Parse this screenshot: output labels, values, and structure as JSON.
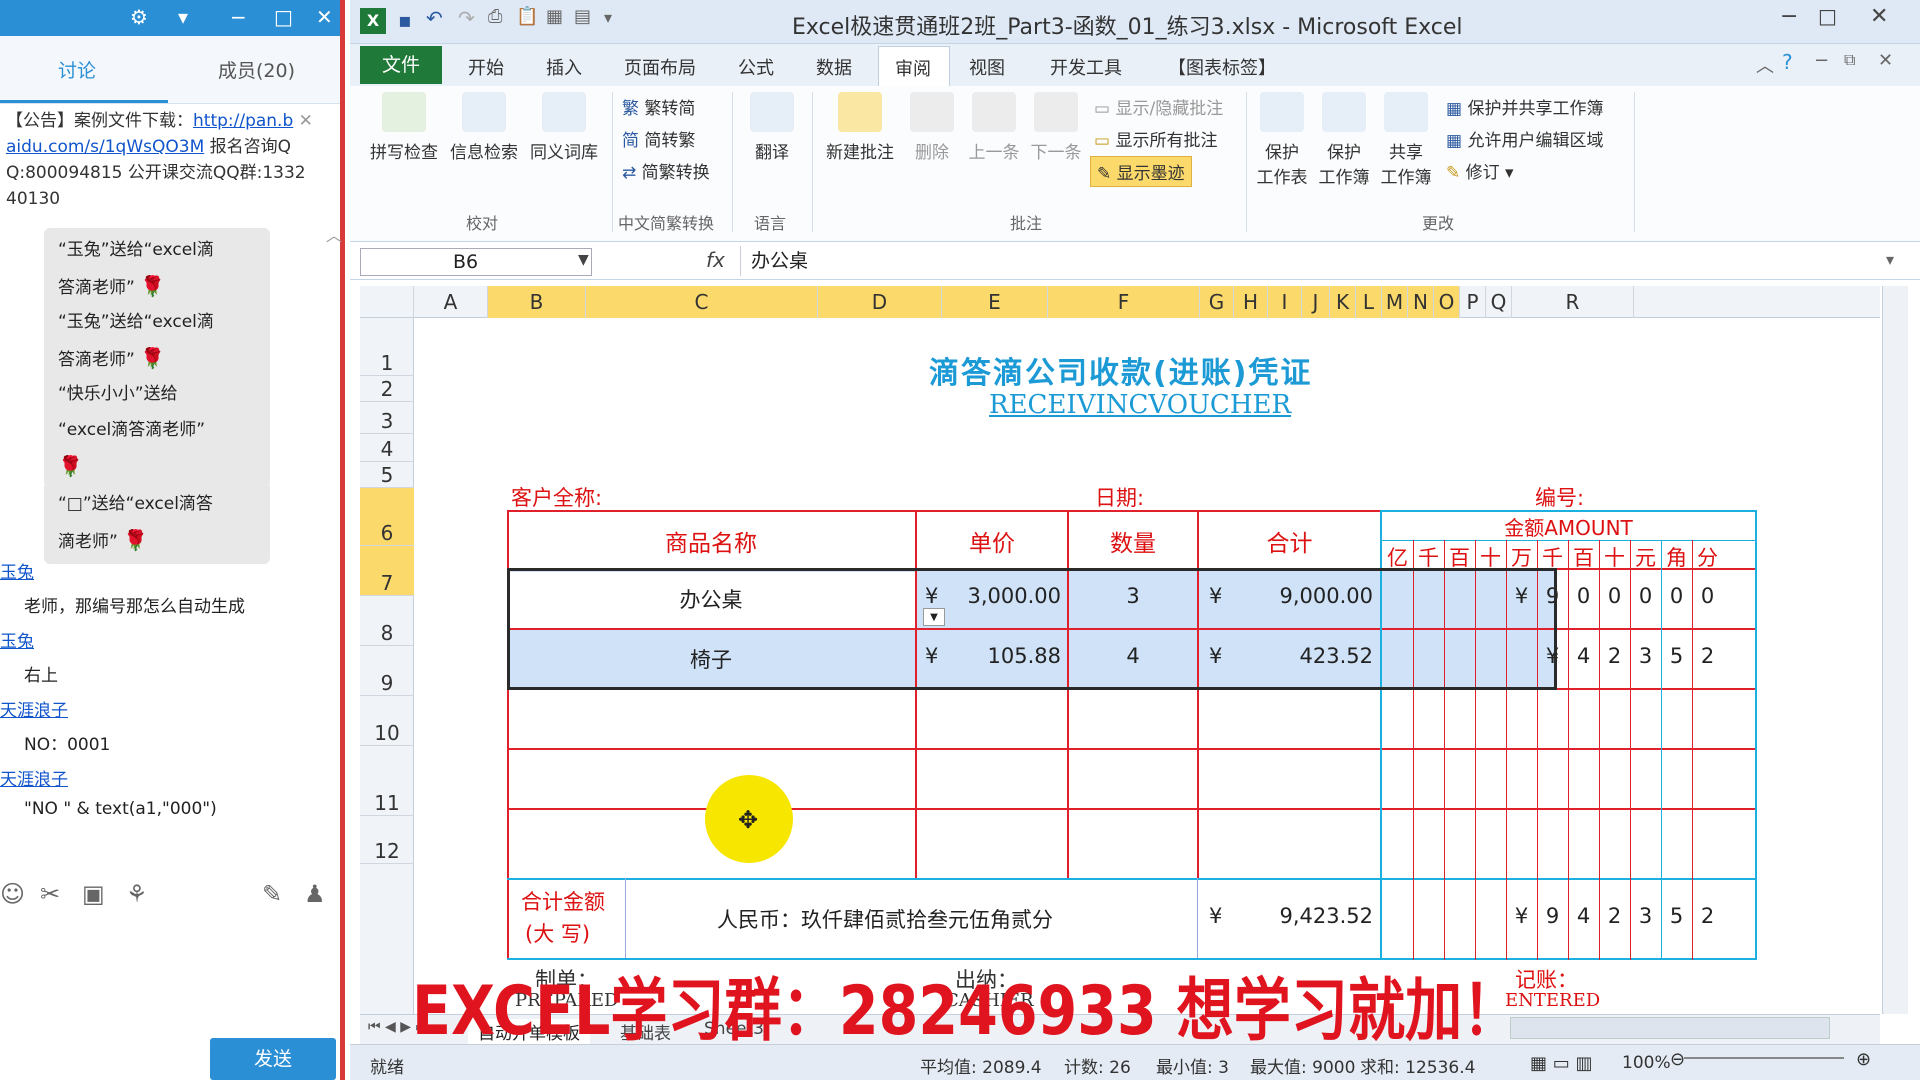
{
  "chat": {
    "tabs": [
      "讨论",
      "成员(20)"
    ],
    "announcement": {
      "prefix": "【公告】",
      "text1": "案例文件下载：",
      "link1": "http://pan.b",
      "link2": "aidu.com/s/1qWsQO3M",
      "text2": " 报名咨询Q",
      "text3": "Q:800094815  公开课交流QQ群:1332",
      "text4": "40130"
    },
    "gifts": [
      {
        "line1": "“玉兔”送给“excel滴",
        "line2": "答滴老师”"
      },
      {
        "line1": "“玉兔”送给“excel滴",
        "line2": "答滴老师”"
      },
      {
        "line1": "“快乐小小”送给",
        "line2": "“excel滴答滴老师”"
      },
      {
        "line1": "“□”送给“excel滴答",
        "line2": "滴老师”"
      }
    ],
    "messages": [
      {
        "user": "玉兔",
        "text": "老师，那编号那怎么自动生成"
      },
      {
        "user": "玉兔",
        "text": "右上"
      },
      {
        "user": "天涯浪子",
        "text": "NO：0001"
      },
      {
        "user": "天涯浪子",
        "text": "\"NO \" &  text(a1,\"000\")"
      }
    ],
    "send_label": "发送"
  },
  "excel": {
    "title": "Excel极速贯通班2班_Part3-函数_01_练习3.xlsx - Microsoft Excel",
    "file_tab": "文件",
    "tabs": [
      "开始",
      "插入",
      "页面布局",
      "公式",
      "数据",
      "审阅",
      "视图",
      "开发工具",
      "【图表标签】"
    ],
    "active_tab": "审阅",
    "ribbon": {
      "proofing": {
        "buttons": [
          "拼写检查",
          "信息检索",
          "同义词库"
        ],
        "group": "校对"
      },
      "chinese": {
        "items": [
          "繁转简",
          "简转繁",
          "简繁转换"
        ],
        "group": "中文简繁转换"
      },
      "language": {
        "button": "翻译",
        "group": "语言"
      },
      "comments": {
        "buttons": [
          "新建批注",
          "删除",
          "上一条",
          "下一条"
        ],
        "items": [
          "显示/隐藏批注",
          "显示所有批注",
          "显示墨迹"
        ],
        "group": "批注"
      },
      "changes": {
        "buttons": [
          [
            "保护",
            "工作表"
          ],
          [
            "保护",
            "工作簿"
          ],
          [
            "共享",
            "工作簿"
          ]
        ],
        "items": [
          "保护并共享工作簿",
          "允许用户编辑区域",
          "修订"
        ],
        "group": "更改"
      }
    },
    "name_box": "B6",
    "formula": "办公桌",
    "columns": [
      "A",
      "B",
      "C",
      "D",
      "E",
      "F",
      "G",
      "H",
      "I",
      "J",
      "K",
      "L",
      "M",
      "N",
      "O",
      "P",
      "Q",
      "R"
    ],
    "selected_columns": [
      "B",
      "C",
      "D",
      "E",
      "F",
      "G",
      "H",
      "I",
      "J",
      "K",
      "L",
      "M",
      "N",
      "O"
    ],
    "rows": [
      "1",
      "2",
      "3",
      "4",
      "5",
      "6",
      "7",
      "8",
      "9",
      "10",
      "11",
      "12"
    ],
    "selected_rows": [
      "6",
      "7"
    ]
  },
  "voucher": {
    "title_cn": "滴答滴公司收款(进账)凭证",
    "title_en": "RECEIVINCVOUCHER",
    "customer_label": "客户全称:",
    "date_label": "日期:",
    "number_label": "编号:",
    "headers": {
      "product": "商品名称",
      "price": "单价",
      "qty": "数量",
      "total": "合计",
      "amount": "金额AMOUNT"
    },
    "digit_headers": [
      "亿",
      "千",
      "百",
      "十",
      "万",
      "千",
      "百",
      "十",
      "元",
      "角",
      "分"
    ],
    "rows": [
      {
        "product": "办公桌",
        "currency": "¥",
        "price": "3,000.00",
        "qty": "3",
        "total": "9,000.00",
        "digits": [
          "",
          "",
          "",
          "",
          "¥",
          "9",
          "0",
          "0",
          "0",
          "0",
          "0"
        ]
      },
      {
        "product": "椅子",
        "currency": "¥",
        "price": "105.88",
        "qty": "4",
        "total": "423.52",
        "digits": [
          "",
          "",
          "",
          "",
          "",
          "¥",
          "4",
          "2",
          "3",
          "5",
          "2"
        ]
      }
    ],
    "sum_label1": "合计金额",
    "sum_label2": "(大  写)",
    "sum_text": "人民币：玖仟肆佰贰拾叁元伍角贰分",
    "sum_currency": "¥",
    "sum_total": "9,423.52",
    "sum_digits": [
      "",
      "",
      "",
      "",
      "¥",
      "9",
      "4",
      "2",
      "3",
      "5",
      "2"
    ],
    "footer": {
      "prepared": "制单：",
      "prepared_en": "PREPARED",
      "cashier": "出纳：",
      "cashier_en": "CASHIER",
      "entered": "记账：",
      "entered_en": "ENTERED"
    }
  },
  "sheet_tabs": [
    "自动开单模板",
    "基础表",
    "Sheet3"
  ],
  "status": {
    "ready": "就绪",
    "average": "平均值: 2089.4",
    "count": "计数: 26",
    "min": "最小值: 3",
    "max": "最大值: 9000",
    "sum": "求和: 12536.4",
    "zoom": "100%"
  },
  "overlay_text": "EXCEL学习群：28246933 想学习就加！"
}
